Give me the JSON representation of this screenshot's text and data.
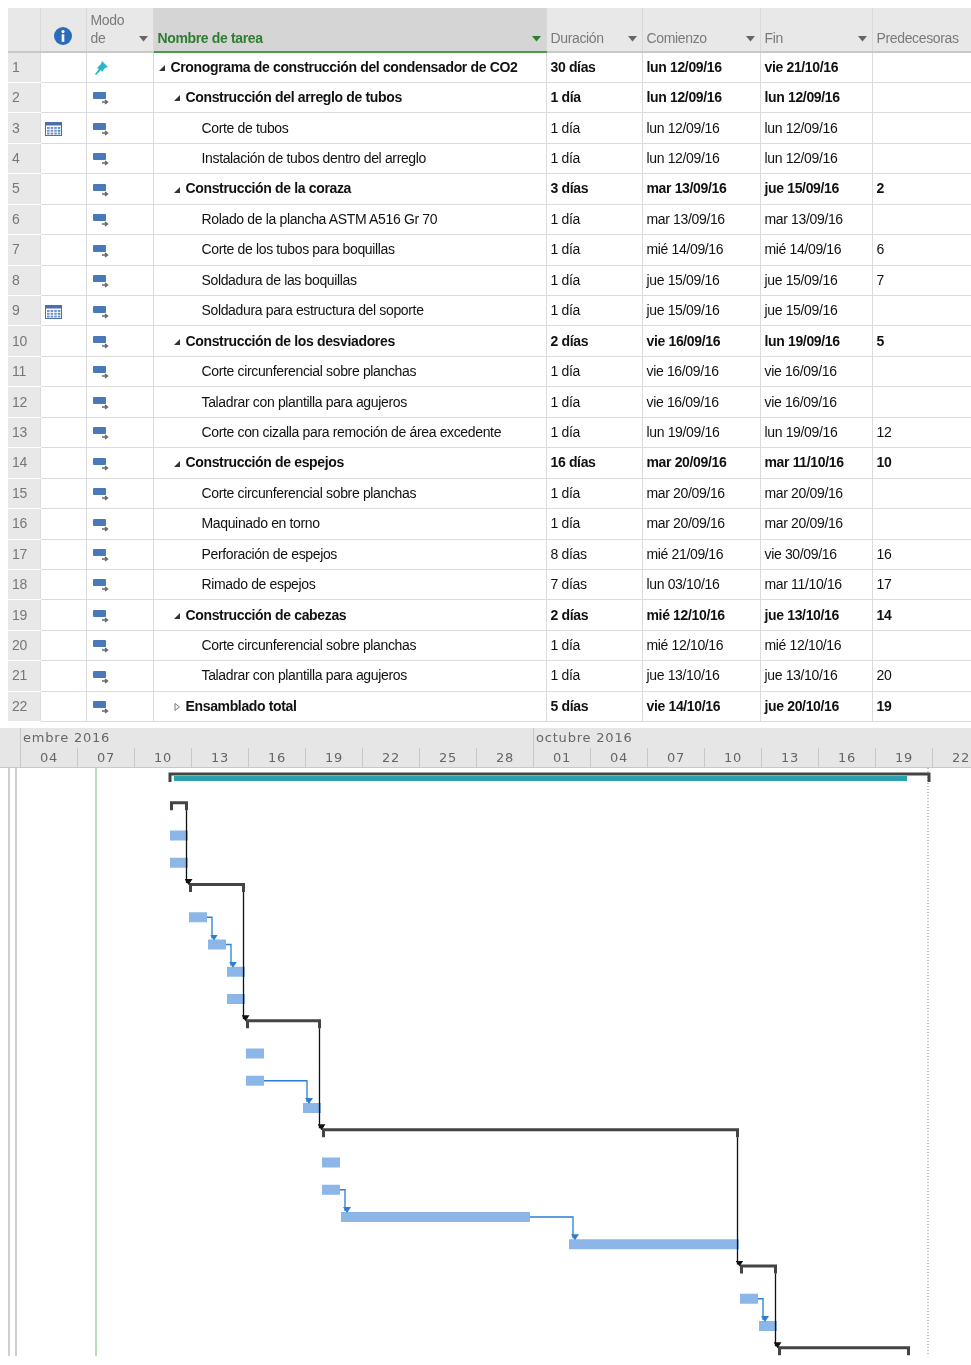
{
  "columns": [
    {
      "kind": "row-number",
      "filter": false,
      "selected": false
    },
    {
      "kind": "indicators",
      "filter": false,
      "selected": false
    },
    {
      "kind": "text",
      "label": "Modo de",
      "filter": true,
      "selected": false
    },
    {
      "kind": "text",
      "label": "Nombre de tarea",
      "filter": true,
      "selected": true
    },
    {
      "kind": "text",
      "label": "Duración",
      "filter": true,
      "selected": false
    },
    {
      "kind": "text",
      "label": "Comienzo",
      "filter": true,
      "selected": false
    },
    {
      "kind": "text",
      "label": "Fin",
      "filter": true,
      "selected": false
    },
    {
      "kind": "text",
      "label": "Predecesoras",
      "filter": false,
      "selected": false
    }
  ],
  "tasks": [
    {
      "row": "1",
      "name": "Cronograma de construcción del condensador de CO2",
      "manual": true,
      "calendar": false,
      "summary": true,
      "expanded": true,
      "duration": "30 días",
      "start": "lun 12/09/16",
      "finish": "vie 21/10/16",
      "children": [
        {
          "row": "2",
          "name": "Construcción del arreglo de tubos",
          "manual": false,
          "calendar": false,
          "summary": true,
          "expanded": true,
          "duration": "1 día",
          "start": "lun 12/09/16",
          "finish": "lun 12/09/16",
          "children": [
            {
              "row": "3",
              "name": "Corte de tubos",
              "manual": false,
              "calendar": true,
              "summary": false,
              "duration": "1 día",
              "start": "lun 12/09/16",
              "finish": "lun 12/09/16"
            },
            {
              "row": "4",
              "name": "Instalación de tubos dentro del arreglo",
              "manual": false,
              "calendar": false,
              "summary": false,
              "duration": "1 día",
              "start": "lun 12/09/16",
              "finish": "lun 12/09/16"
            }
          ]
        },
        {
          "row": "5",
          "name": "Construcción de la coraza",
          "manual": false,
          "calendar": false,
          "summary": true,
          "expanded": true,
          "duration": "3 días",
          "start": "mar 13/09/16",
          "finish": "jue 15/09/16",
          "predecessors": "2",
          "children": [
            {
              "row": "6",
              "name": "Rolado de la plancha ASTM A516 Gr 70",
              "manual": false,
              "calendar": false,
              "summary": false,
              "duration": "1 día",
              "start": "mar 13/09/16",
              "finish": "mar 13/09/16"
            },
            {
              "row": "7",
              "name": "Corte de los tubos para boquillas",
              "manual": false,
              "calendar": false,
              "summary": false,
              "duration": "1 día",
              "start": "mié 14/09/16",
              "finish": "mié 14/09/16",
              "predecessors": "6"
            },
            {
              "row": "8",
              "name": "Soldadura de las boquillas",
              "manual": false,
              "calendar": false,
              "summary": false,
              "duration": "1 día",
              "start": "jue 15/09/16",
              "finish": "jue 15/09/16",
              "predecessors": "7"
            },
            {
              "row": "9",
              "name": "Soldadura para estructura del soporte",
              "manual": false,
              "calendar": true,
              "summary": false,
              "duration": "1 día",
              "start": "jue 15/09/16",
              "finish": "jue 15/09/16"
            }
          ]
        },
        {
          "row": "10",
          "name": "Construcción de los desviadores",
          "manual": false,
          "calendar": false,
          "summary": true,
          "expanded": true,
          "duration": "2 días",
          "start": "vie 16/09/16",
          "finish": "lun 19/09/16",
          "predecessors": "5",
          "children": [
            {
              "row": "11",
              "name": "Corte circunferencial sobre planchas",
              "manual": false,
              "calendar": false,
              "summary": false,
              "duration": "1 día",
              "start": "vie 16/09/16",
              "finish": "vie 16/09/16"
            },
            {
              "row": "12",
              "name": "Taladrar con plantilla para agujeros",
              "manual": false,
              "calendar": false,
              "summary": false,
              "duration": "1 día",
              "start": "vie 16/09/16",
              "finish": "vie 16/09/16"
            },
            {
              "row": "13",
              "name": "Corte con cizalla para remoción de área excedente",
              "manual": false,
              "calendar": false,
              "summary": false,
              "duration": "1 día",
              "start": "lun 19/09/16",
              "finish": "lun 19/09/16",
              "predecessors": "12"
            }
          ]
        },
        {
          "row": "14",
          "name": "Construcción de espejos",
          "manual": false,
          "calendar": false,
          "summary": true,
          "expanded": true,
          "duration": "16 días",
          "start": "mar 20/09/16",
          "finish": "mar 11/10/16",
          "predecessors": "10",
          "children": [
            {
              "row": "15",
              "name": "Corte circunferencial sobre planchas",
              "manual": false,
              "calendar": false,
              "summary": false,
              "duration": "1 día",
              "start": "mar 20/09/16",
              "finish": "mar 20/09/16"
            },
            {
              "row": "16",
              "name": "Maquinado en torno",
              "manual": false,
              "calendar": false,
              "summary": false,
              "duration": "1 día",
              "start": "mar 20/09/16",
              "finish": "mar 20/09/16"
            },
            {
              "row": "17",
              "name": "Perforación de espejos",
              "manual": false,
              "calendar": false,
              "summary": false,
              "duration": "8 días",
              "start": "mié 21/09/16",
              "finish": "vie 30/09/16",
              "predecessors": "16"
            },
            {
              "row": "18",
              "name": "Rimado de espejos",
              "manual": false,
              "calendar": false,
              "summary": false,
              "duration": "7 días",
              "start": "lun 03/10/16",
              "finish": "mar 11/10/16",
              "predecessors": "17"
            }
          ]
        },
        {
          "row": "19",
          "name": "Construcción de cabezas",
          "manual": false,
          "calendar": false,
          "summary": true,
          "expanded": true,
          "duration": "2 días",
          "start": "mié 12/10/16",
          "finish": "jue 13/10/16",
          "predecessors": "14",
          "children": [
            {
              "row": "20",
              "name": "Corte circunferencial sobre planchas",
              "manual": false,
              "calendar": false,
              "summary": false,
              "duration": "1 día",
              "start": "mié 12/10/16",
              "finish": "mié 12/10/16"
            },
            {
              "row": "21",
              "name": "Taladrar con plantilla para agujeros",
              "manual": false,
              "calendar": false,
              "summary": false,
              "duration": "1 día",
              "start": "jue 13/10/16",
              "finish": "jue 13/10/16",
              "predecessors": "20"
            }
          ]
        },
        {
          "row": "22",
          "name": "Ensamblado total",
          "manual": false,
          "calendar": false,
          "summary": true,
          "expanded": false,
          "duration": "5 días",
          "start": "vie 14/10/16",
          "finish": "jue 20/10/16",
          "predecessors": "19"
        }
      ]
    }
  ],
  "timescale": {
    "months": [
      "embre 2016",
      "octubre 2016"
    ],
    "days": [
      "04",
      "07",
      "10",
      "13",
      "16",
      "19",
      "22",
      "25",
      "28",
      "01",
      "04",
      "07",
      "10",
      "13",
      "16",
      "19",
      "22"
    ]
  }
}
